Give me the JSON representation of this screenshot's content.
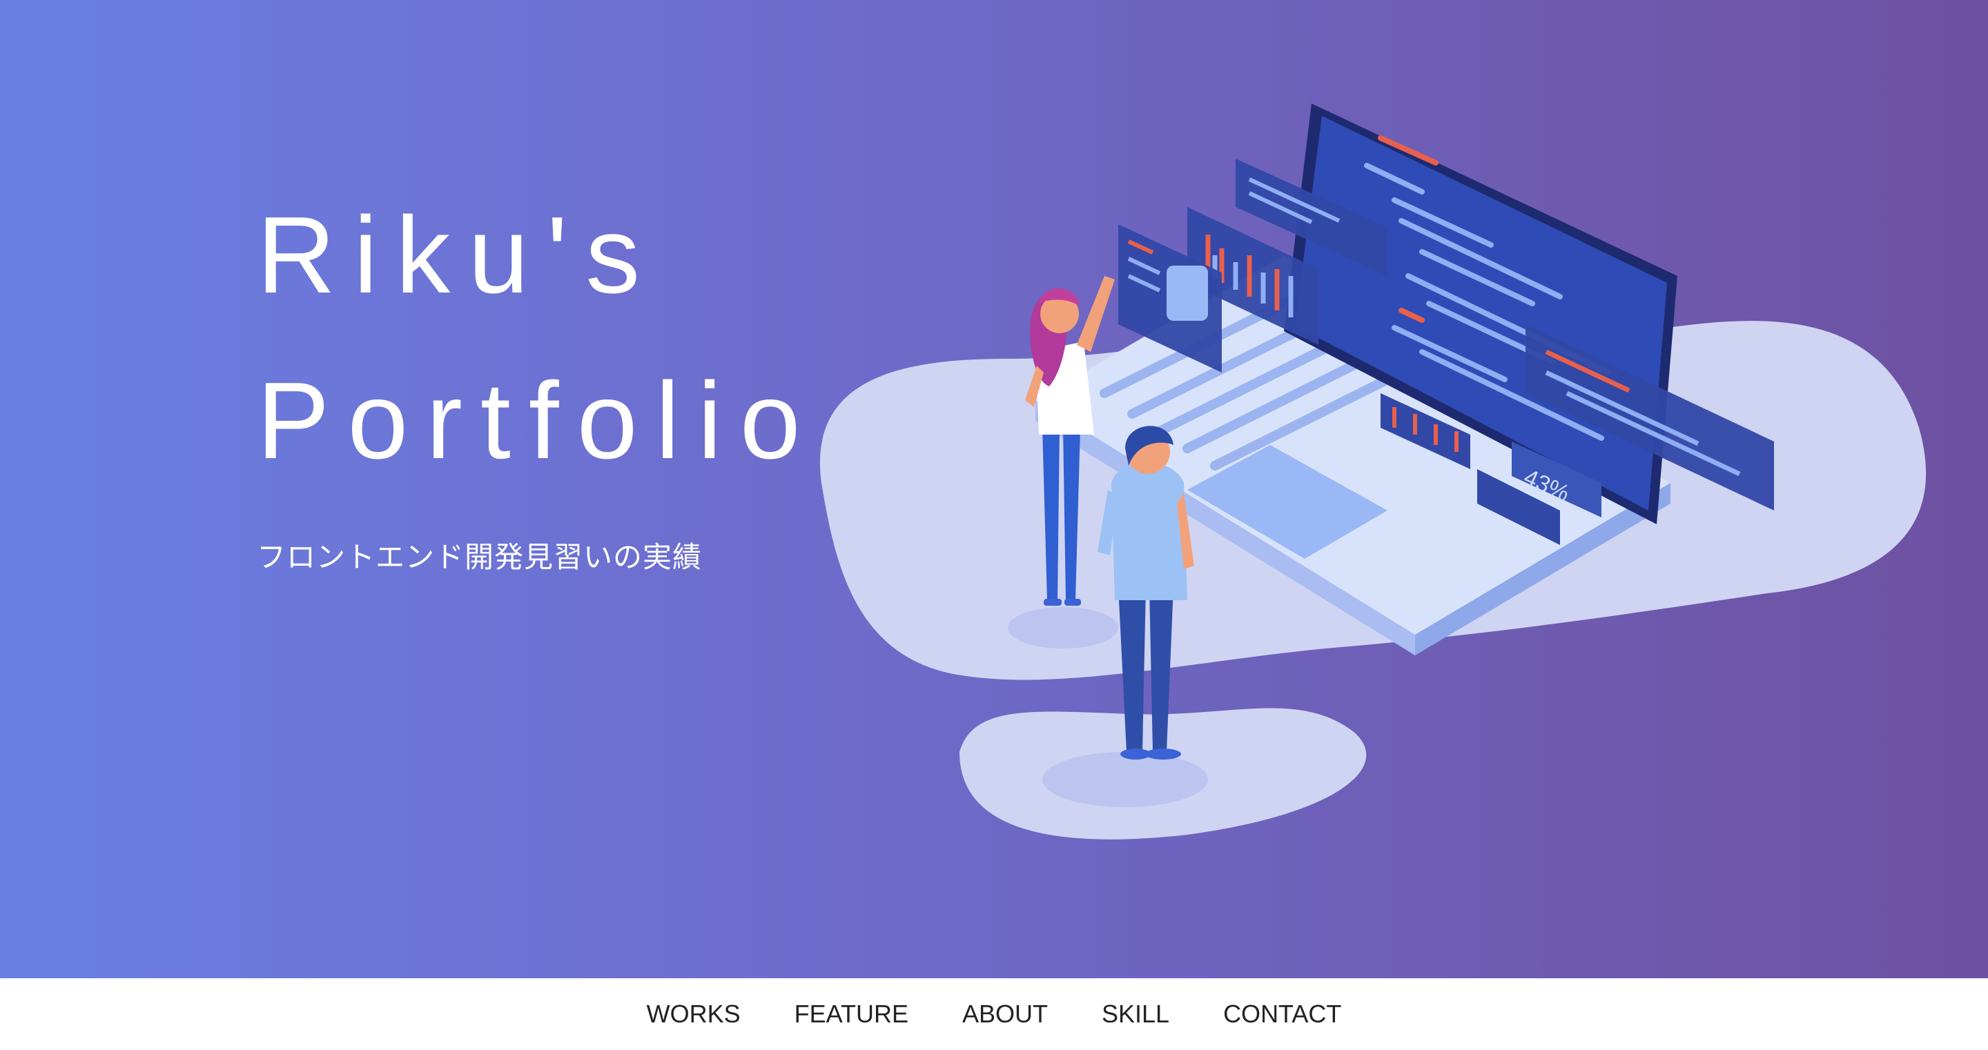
{
  "hero": {
    "title_line1": "Riku's",
    "title_line2": "Portfolio",
    "subtitle": "フロントエンド開発見習いの実績",
    "illustration_badge": "43%"
  },
  "nav": {
    "items": [
      {
        "label": "WORKS"
      },
      {
        "label": "FEATURE"
      },
      {
        "label": "ABOUT"
      },
      {
        "label": "SKILL"
      },
      {
        "label": "CONTACT"
      }
    ]
  },
  "colors": {
    "gradient_start": "#6a7fe2",
    "gradient_end": "#6e51a1",
    "nav_text": "#222222"
  }
}
